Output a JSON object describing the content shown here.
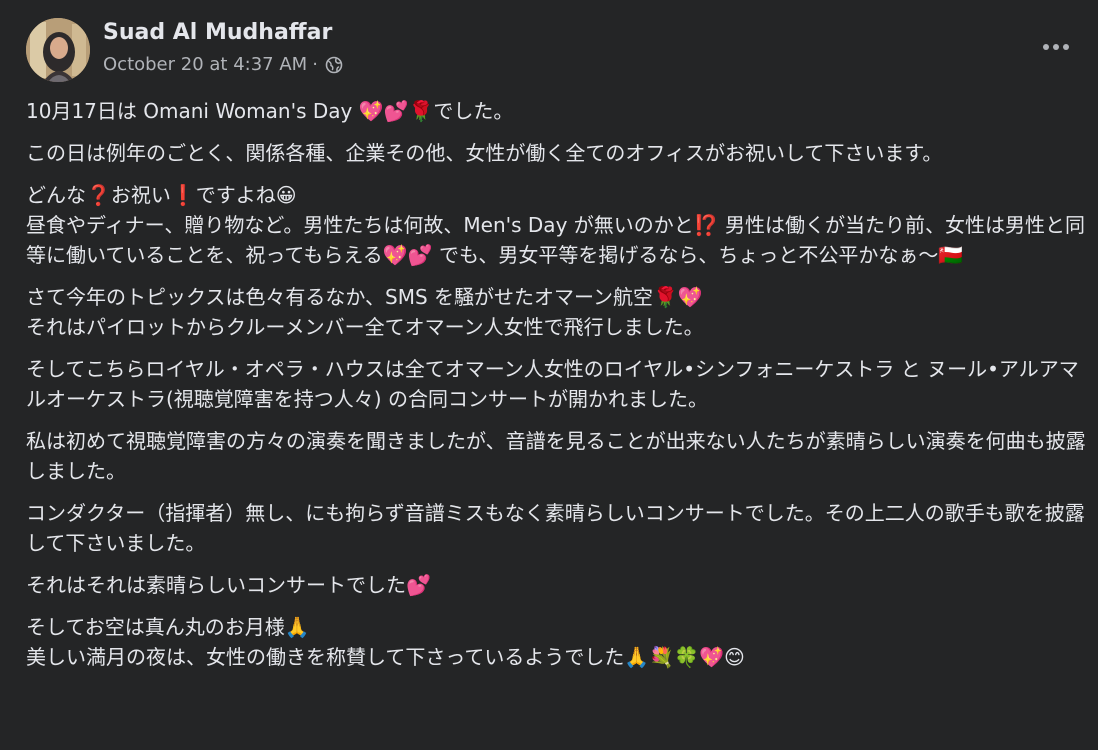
{
  "post": {
    "author": "Suad Al Mudhaffar",
    "timestamp": "October 20 at 4:37 AM",
    "separator": "·",
    "privacy_icon": "globe-icon",
    "more_icon": "more-options-icon",
    "paragraphs": [
      "10月17日は Omani Woman's Day 💖💕🌹でした。",
      "この日は例年のごとく、関係各種、企業その他、女性が働く全てのオフィスがお祝いして下さいます。",
      "どんな❓お祝い❗ですよね😀\n昼食やディナー、贈り物など。男性たちは何故、Men's Day が無いのかと⁉️ 男性は働くが当たり前、女性は男性と同等に働いていることを、祝ってもらえる💖💕 でも、男女平等を掲げるなら、ちょっと不公平かなぁ〜🇴🇲",
      "さて今年のトピックスは色々有るなか、SMS を騒がせたオマーン航空🌹💖\nそれはパイロットからクルーメンバー全てオマーン人女性で飛行しました。",
      "そしてこちらロイヤル・オペラ・ハウスは全てオマーン人女性のロイヤル•シンフォニーケストラ と ヌール•アルアマルオーケストラ(視聴覚障害を持つ人々) の合同コンサートが開かれました。",
      "私は初めて視聴覚障害の方々の演奏を聞きましたが、音譜を見ることが出来ない人たちが素晴らしい演奏を何曲も披露しました。",
      "コンダクター（指揮者）無し、にも拘らず音譜ミスもなく素晴らしいコンサートでした。その上二人の歌手も歌を披露して下さいました。",
      "それはそれは素晴らしいコンサートでした💕",
      "そしてお空は真ん丸のお月様🙏\n美しい満月の夜は、女性の働きを称賛して下さっているようでした🙏💐🍀💖😊"
    ]
  }
}
